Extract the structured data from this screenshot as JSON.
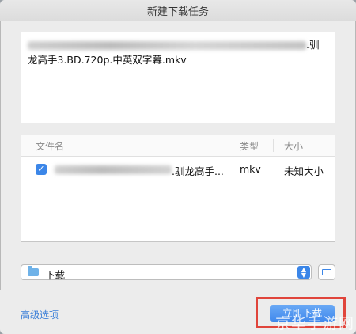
{
  "window": {
    "title": "新建下载任务"
  },
  "url_box": {
    "line1_suffix": ".驯",
    "line2": "龙高手3.BD.720p.中英双字幕.mkv"
  },
  "file_list": {
    "columns": [
      "文件名",
      "类型",
      "大小"
    ],
    "rows": [
      {
        "checked": true,
        "name_suffix": ".驯龙高手...",
        "type": "mkv",
        "size": "未知大小"
      }
    ]
  },
  "folder": {
    "selected": "下载"
  },
  "footer": {
    "advanced_label": "高级选项",
    "start_label": "立即下载"
  },
  "watermark": "京华手游网",
  "colors": {
    "accent": "#3b86e8",
    "highlight": "#e0453b"
  }
}
